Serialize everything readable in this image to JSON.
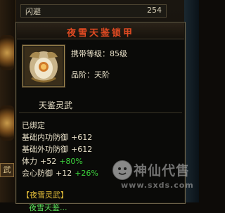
{
  "background": {
    "row_label": "闪避",
    "row_value": "254",
    "side_tag": "武"
  },
  "tooltip": {
    "title": "夜雪天鉴锁甲",
    "carry_level": "携带等级：85级",
    "grade": "品阶：天阶",
    "sub_name": "天鉴灵武",
    "bound": "已绑定",
    "stats": [
      {
        "label": "基础内功防御",
        "base": "+612",
        "bonus": ""
      },
      {
        "label": "基础外功防御",
        "base": "+612",
        "bonus": ""
      },
      {
        "label": "体力",
        "base": "+52",
        "bonus": "+80%"
      },
      {
        "label": "会心防御",
        "base": "+12",
        "bonus": "+26%"
      }
    ],
    "set_title": "【夜雪灵武】",
    "set_item": "夜雪天鉴..."
  },
  "watermark": {
    "text": "神仙代售",
    "url": "www.sxds.com"
  },
  "colors": {
    "title": "#e04a22",
    "bonus": "#3cd23c",
    "set_title": "#e8c23a",
    "border": "#6a6048"
  },
  "icons": {
    "item_icon": "armor-icon",
    "logo": "mascot-logo-icon"
  }
}
